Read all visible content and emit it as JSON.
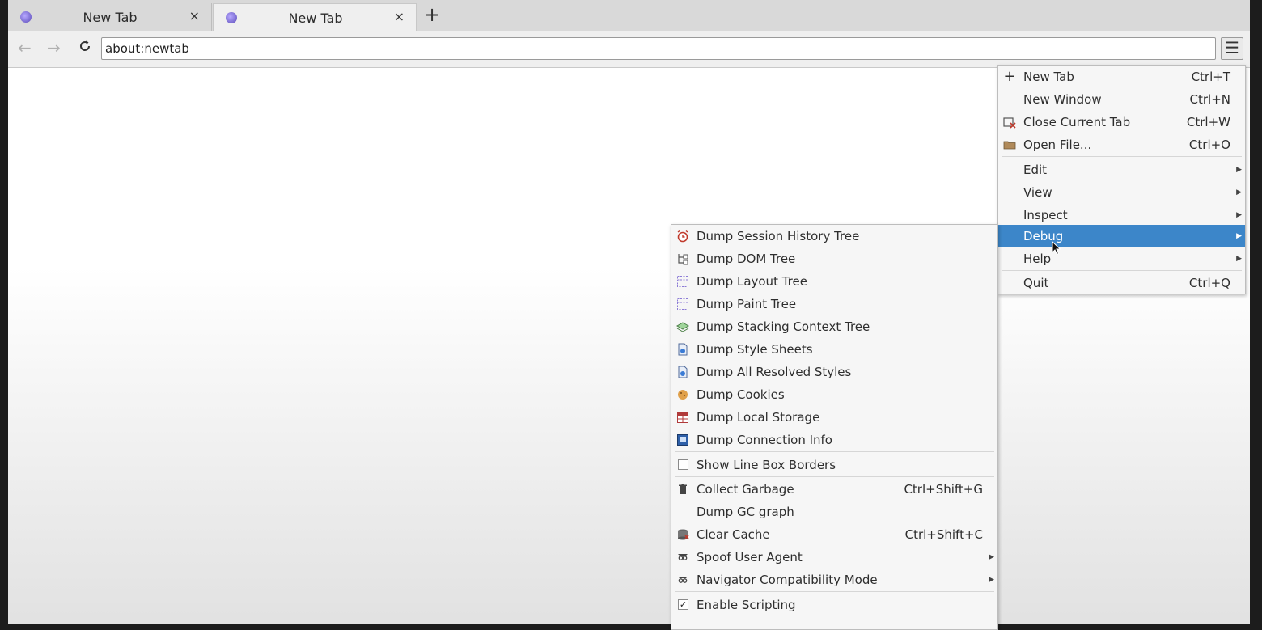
{
  "tabs": [
    {
      "title": "New Tab",
      "close": "×",
      "active": false
    },
    {
      "title": "New Tab",
      "close": "×",
      "active": true
    }
  ],
  "tabbar": {
    "new_tab": "+"
  },
  "navbar": {
    "back": "←",
    "forward": "→",
    "reload": "C",
    "url": "about:newtab",
    "menu": "☰"
  },
  "main_menu": {
    "items": [
      {
        "label": "New Tab",
        "shortcut": "Ctrl+T",
        "icon": "plus-icon"
      },
      {
        "label": "New Window",
        "shortcut": "Ctrl+N"
      },
      {
        "label": "Close Current Tab",
        "shortcut": "Ctrl+W",
        "icon": "close-tab-icon"
      },
      {
        "label": "Open File...",
        "shortcut": "Ctrl+O",
        "icon": "folder-icon"
      },
      {
        "label": "Edit",
        "submenu": true
      },
      {
        "label": "View",
        "submenu": true
      },
      {
        "label": "Inspect",
        "submenu": true
      },
      {
        "label": "Debug",
        "submenu": true,
        "highlighted": true
      },
      {
        "label": "Help",
        "submenu": true
      },
      {
        "label": "Quit",
        "shortcut": "Ctrl+Q"
      }
    ]
  },
  "debug_menu": {
    "items": [
      {
        "label": "Dump Session History Tree",
        "icon": "history-icon"
      },
      {
        "label": "Dump DOM Tree",
        "icon": "dom-tree-icon"
      },
      {
        "label": "Dump Layout Tree",
        "icon": "layout-icon"
      },
      {
        "label": "Dump Paint Tree",
        "icon": "paint-icon"
      },
      {
        "label": "Dump Stacking Context Tree",
        "icon": "layers-icon"
      },
      {
        "label": "Dump Style Sheets",
        "icon": "stylesheet-icon"
      },
      {
        "label": "Dump All Resolved Styles",
        "icon": "resolved-styles-icon"
      },
      {
        "label": "Dump Cookies",
        "icon": "cookie-icon"
      },
      {
        "label": "Dump Local Storage",
        "icon": "storage-icon"
      },
      {
        "label": "Dump Connection Info",
        "icon": "connection-icon"
      },
      {
        "label": "Show Line Box Borders",
        "checkbox": true,
        "checked": false
      },
      {
        "label": "Collect Garbage",
        "shortcut": "Ctrl+Shift+G",
        "icon": "trash-icon"
      },
      {
        "label": "Dump GC graph"
      },
      {
        "label": "Clear Cache",
        "shortcut": "Ctrl+Shift+C",
        "icon": "cache-icon"
      },
      {
        "label": "Spoof User Agent",
        "submenu": true,
        "icon": "spoof-icon"
      },
      {
        "label": "Navigator Compatibility Mode",
        "submenu": true,
        "icon": "compat-icon"
      },
      {
        "label": "Enable Scripting",
        "checkbox": true,
        "checked": true,
        "check_mark": "✓"
      }
    ]
  },
  "colors": {
    "highlight": "#3c86c9",
    "menu_bg": "#f6f6f6",
    "chrome_bg": "#efefef"
  }
}
